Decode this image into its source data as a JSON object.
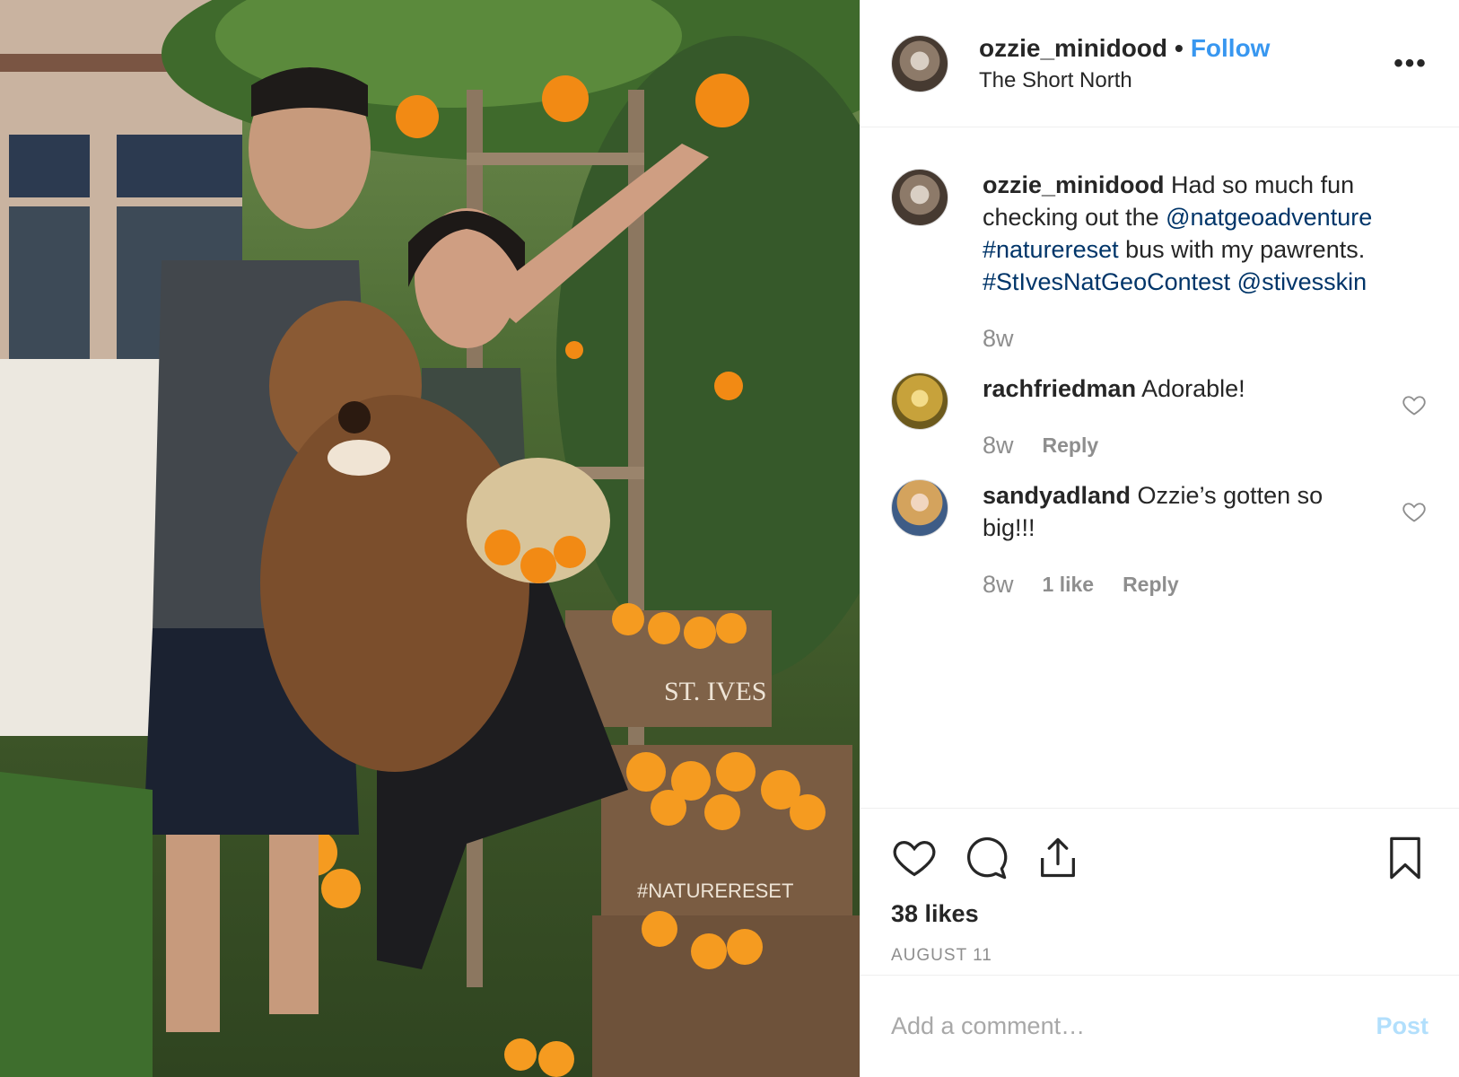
{
  "header": {
    "username": "ozzie_minidood",
    "separator": "•",
    "follow_label": "Follow",
    "location": "The Short North",
    "more_label": "•••"
  },
  "caption": {
    "username": "ozzie_minidood",
    "text_1": " Had so much fun checking out the ",
    "mention_1": "@natgeoadventure",
    "space_1": " ",
    "hashtag_1": "#naturereset",
    "text_2": " bus with my pawrents. ",
    "hashtag_2": "#StIvesNatGeoContest",
    "space_2": " ",
    "mention_2": "@stivesskin",
    "time": "8w"
  },
  "comments": [
    {
      "username": "rachfriedman",
      "text": " Adorable!",
      "time": "8w",
      "reply_label": "Reply"
    },
    {
      "username": "sandyadland",
      "text": " Ozzie’s gotten so big!!!",
      "time": "8w",
      "likes": "1 like",
      "reply_label": "Reply"
    }
  ],
  "actions": {
    "likes": "38 likes",
    "date": "AUGUST 11"
  },
  "add_comment": {
    "placeholder": "Add a comment…",
    "post_label": "Post"
  },
  "colors": {
    "accent": "#3897f0",
    "mention": "#003569",
    "muted": "#8e8e8e",
    "post_disabled": "#b2dffc"
  },
  "photo": {
    "crate_text_1": "ST. IVES",
    "crate_text_2": "#NATURERESET"
  }
}
